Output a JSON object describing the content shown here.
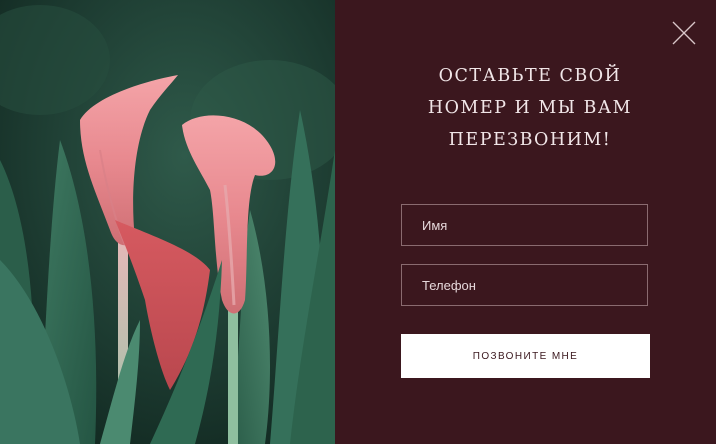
{
  "popup": {
    "title": "Оставьте свой номер и мы вам перезвоним!",
    "title_lines": [
      "ОСТАВЬТЕ СВОЙ",
      "НОМЕР И МЫ ВАМ",
      "ПЕРЕЗВОНИМ!"
    ],
    "close_icon": "close-icon",
    "form": {
      "name_placeholder": "Имя",
      "phone_placeholder": "Телефон",
      "submit_label": "ПОЗВОНИТЕ МНЕ"
    }
  },
  "colors": {
    "panel_background": "#3b171e",
    "button_background": "#ffffff",
    "text_light": "#f1e6e8"
  }
}
